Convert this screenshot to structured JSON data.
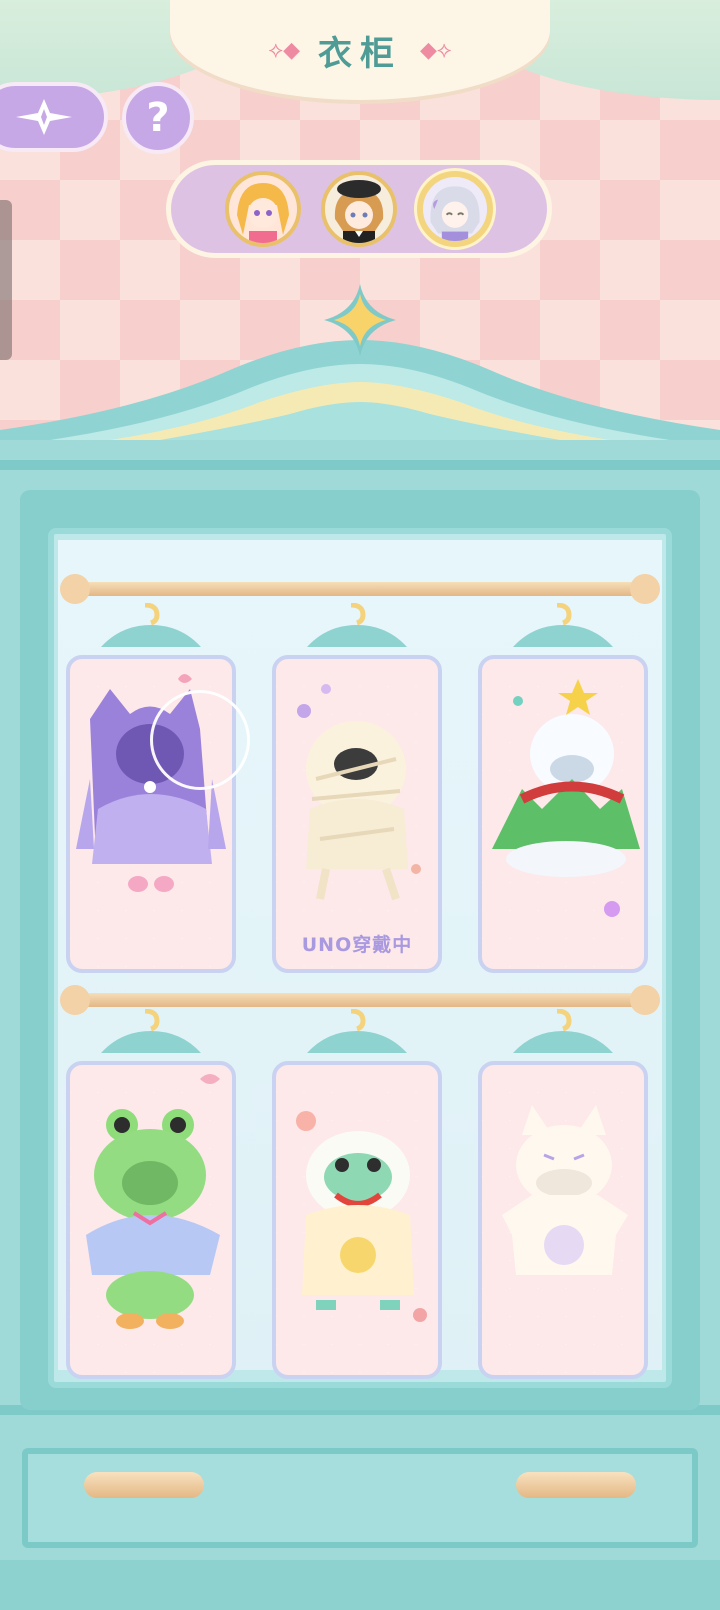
{
  "header": {
    "title": "衣柜",
    "back_icon": "compass-star-icon",
    "help_label": "?"
  },
  "characters": [
    {
      "name_icon": "blonde-girl-avatar",
      "selected": false
    },
    {
      "name_icon": "beret-girl-avatar",
      "selected": false
    },
    {
      "name_icon": "silver-hair-girl-avatar",
      "selected": true
    }
  ],
  "wardrobe": {
    "outfits": [
      {
        "icon": "purple-cat-hoodie-outfit",
        "status": ""
      },
      {
        "icon": "mummy-bandage-outfit",
        "status": "UNO穿戴中"
      },
      {
        "icon": "christmas-tree-snowman-outfit",
        "status": ""
      },
      {
        "icon": "green-frog-cape-outfit",
        "status": ""
      },
      {
        "icon": "lion-dance-outfit",
        "status": ""
      },
      {
        "icon": "white-cat-locked-outfit",
        "status": ""
      }
    ]
  },
  "colors": {
    "accent_purple": "#c7a8e6",
    "wardrobe_teal": "#9fd9d8",
    "title_teal": "#4f9c96",
    "status_text": "#a899e0"
  }
}
